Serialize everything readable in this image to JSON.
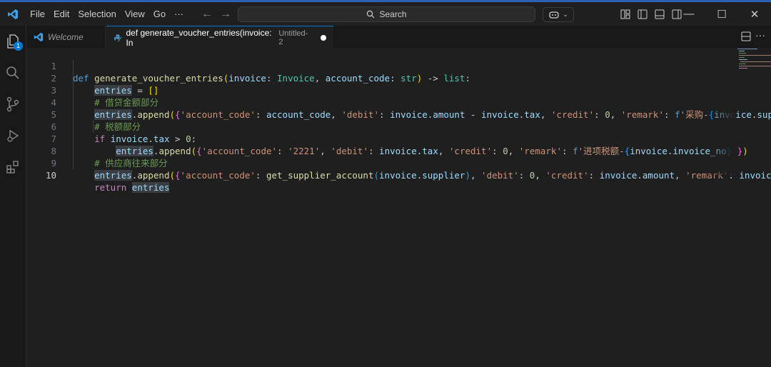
{
  "menu": [
    "File",
    "Edit",
    "Selection",
    "View",
    "Go",
    "···"
  ],
  "search": {
    "label": "Search"
  },
  "tabs": [
    {
      "label": "Welcome",
      "icon": "vscode-icon"
    },
    {
      "label": "def generate_voucher_entries(invoice: In",
      "description": "Untitled-2",
      "icon": "python-icon",
      "dirty": true
    }
  ],
  "activity_badge": "1",
  "line_numbers": [
    "1",
    "2",
    "3",
    "4",
    "5",
    "6",
    "7",
    "8",
    "9",
    "10"
  ],
  "editor": {
    "current_line": 10,
    "lines": [
      "def generate_voucher_entries(invoice: Invoice, account_code: str) -> list:",
      "    entries = []",
      "    # 借贷金额部分",
      "    entries.append({'account_code': account_code, 'debit': invoice.amount - invoice.tax, 'credit': 0, 'remark': f'采购-{invoice.supplier}",
      "    # 税额部分",
      "    if invoice.tax > 0:",
      "        entries.append({'account_code': '2221', 'debit': invoice.tax, 'credit': 0, 'remark': f'进项税额-{invoice.invoice_no}'})",
      "    # 供应商往来部分",
      "    entries.append({'account_code': get_supplier_account(invoice.supplier), 'debit': 0, 'credit': invoice.amount, 'remark': invoice.supplier",
      "    return entries"
    ]
  },
  "colors": {
    "background": "#1f1f1f",
    "accent": "#0078d4",
    "keyword": "#569cd6",
    "function": "#dcdcaa",
    "string": "#ce9178",
    "comment": "#6a9955"
  }
}
